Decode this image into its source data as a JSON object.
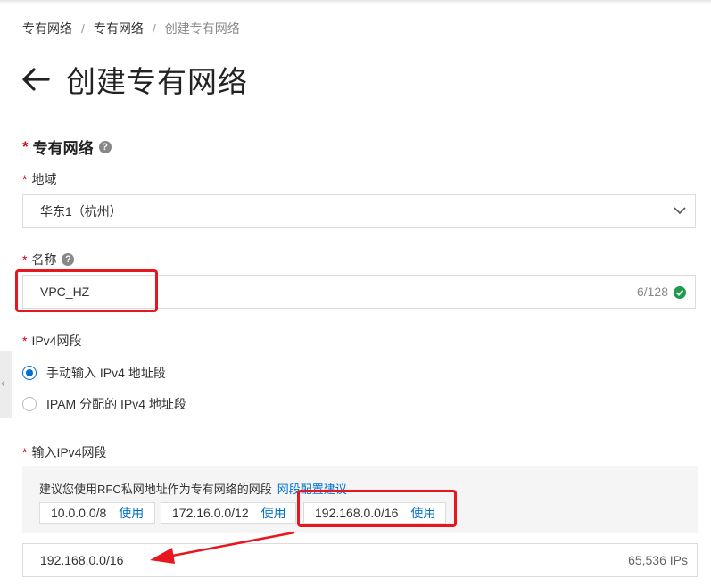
{
  "breadcrumb": {
    "items": [
      "专有网络",
      "专有网络",
      "创建专有网络"
    ],
    "separator": "/"
  },
  "page": {
    "title": "创建专有网络"
  },
  "section": {
    "title": "专有网络",
    "required_mark": "*",
    "help_icon": "question-circle-icon"
  },
  "region": {
    "label": "地域",
    "required_mark": "*",
    "value": "华东1（杭州）"
  },
  "name": {
    "label": "名称",
    "required_mark": "*",
    "value": "VPC_HZ",
    "count": "6/128",
    "status_icon": "check-circle-icon"
  },
  "ipv4_mode": {
    "label": "IPv4网段",
    "required_mark": "*",
    "options": [
      {
        "label": "手动输入 IPv4 地址段",
        "selected": true
      },
      {
        "label": "IPAM 分配的 IPv4 地址段",
        "selected": false
      }
    ]
  },
  "ipv4_input": {
    "label": "输入IPv4网段",
    "required_mark": "*",
    "suggestion_text": "建议您使用RFC私网地址作为专有网络的网段",
    "suggestion_link": "网段配置建议",
    "presets": [
      {
        "cidr": "10.0.0.0/8",
        "action": "使用"
      },
      {
        "cidr": "172.16.0.0/12",
        "action": "使用"
      },
      {
        "cidr": "192.168.0.0/16",
        "action": "使用"
      }
    ],
    "value": "192.168.0.0/16",
    "ip_count": "65,536 IPs"
  },
  "colors": {
    "accent": "#0070cc",
    "required": "#d0021b",
    "highlight": "#e8161f",
    "success": "#1f9b4d"
  }
}
